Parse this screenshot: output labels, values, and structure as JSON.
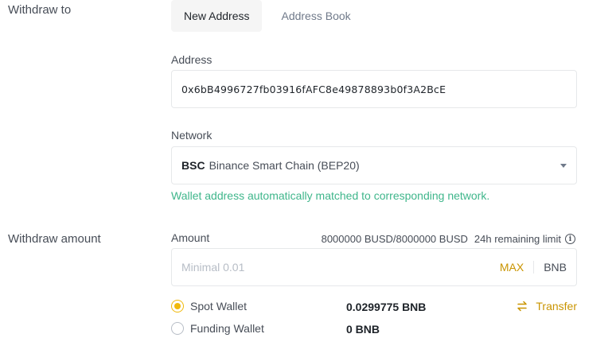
{
  "withdraw_to": {
    "label": "Withdraw to",
    "tabs": [
      {
        "label": "New Address",
        "active": true
      },
      {
        "label": "Address Book",
        "active": false
      }
    ],
    "address": {
      "label": "Address",
      "value": "0x6bB4996727fb03916fAFC8e49878893b0f3A2BcE"
    },
    "network": {
      "label": "Network",
      "code": "BSC",
      "name": "Binance Smart Chain (BEP20)",
      "icon": "chevron-down-icon"
    },
    "match_message": "Wallet address automatically matched to corresponding network."
  },
  "withdraw_amount": {
    "label": "Withdraw amount",
    "amount_label": "Amount",
    "limit": "8000000 BUSD/8000000 BUSD",
    "limit_note": "24h remaining limit",
    "info_icon": "info-icon",
    "placeholder": "Minimal 0.01",
    "max_label": "MAX",
    "coin": "BNB",
    "wallets": [
      {
        "label": "Spot Wallet",
        "balance": "0.0299775 BNB",
        "selected": true
      },
      {
        "label": "Funding Wallet",
        "balance": "0 BNB",
        "selected": false
      }
    ],
    "transfer": {
      "label": "Transfer",
      "icon": "transfer-arrows-icon"
    }
  },
  "colors": {
    "accent": "#f0b90b",
    "link": "#c99400",
    "success": "#3fb68b",
    "border": "#e6e8ea"
  }
}
